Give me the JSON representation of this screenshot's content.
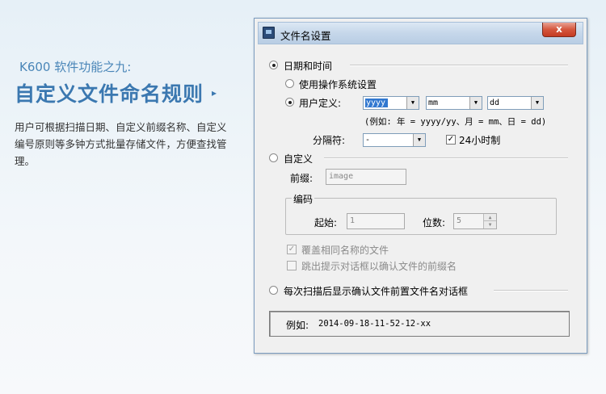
{
  "promo": {
    "subtitle": "K600 软件功能之九:",
    "title": "自定义文件命名规则",
    "arrow": "▸",
    "description": "用户可根据扫描日期、自定义前缀名称、自定义编号原则等多钟方式批量存储文件，方便查找管理。"
  },
  "dialog": {
    "title": "文件名设置",
    "close_label": "x",
    "date_time": {
      "label": "日期和时间",
      "use_system": "使用操作系统设置",
      "user_defined": "用户定义:",
      "year_value": "yyyy",
      "month_value": "mm",
      "day_value": "dd",
      "format_hint": "(例如: 年 = yyyy/yy、月 = mm、日 = dd)",
      "separator_label": "分隔符:",
      "separator_value": "-",
      "hour24_label": "24小时制",
      "hour24_checked": true
    },
    "custom": {
      "label": "自定义",
      "prefix_label": "前缀:",
      "prefix_value": "image",
      "encoding_label": "编码",
      "start_label": "起始:",
      "start_value": "1",
      "digits_label": "位数:",
      "digits_value": "5",
      "overwrite_label": "覆盖相同名称的文件",
      "overwrite_checked": true,
      "skip_prompt_label": "跳出提示对话框以确认文件的前缀名",
      "skip_prompt_checked": false
    },
    "prompt_each_scan": {
      "label": "每次扫描后显示确认文件前置文件名对话框"
    },
    "example": {
      "label": "例如:",
      "value": "2014-09-18-11-52-12-xx"
    }
  }
}
